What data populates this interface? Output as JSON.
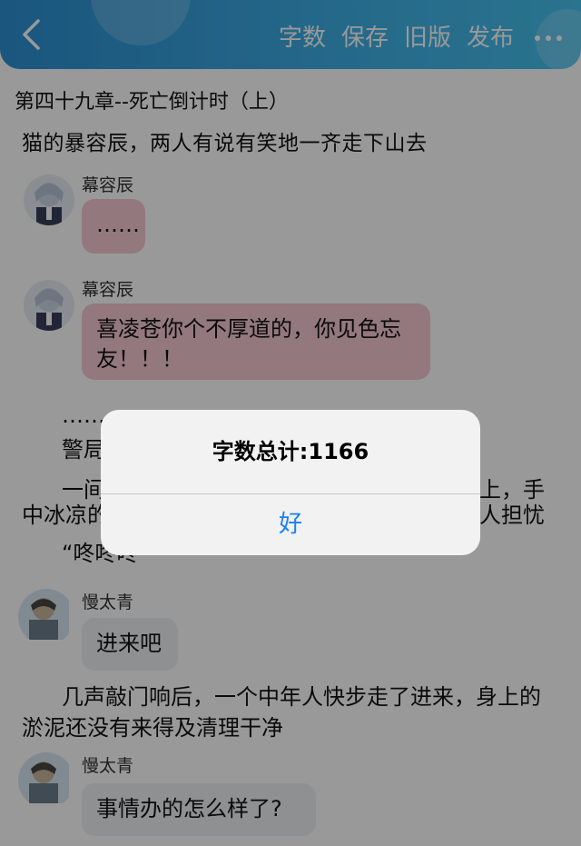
{
  "header": {
    "toolbar": [
      "字数",
      "保存",
      "旧版",
      "发布"
    ]
  },
  "chapter": {
    "title": "第四十九章--死亡倒计时（上）",
    "clipped_line": "猫的暴容辰，两人有说有笑地一齐走下山去"
  },
  "messages": [
    {
      "name": "幕容辰",
      "text": "……"
    },
    {
      "name": "幕容辰",
      "text": "喜凌苍你个不厚道的，你见色忘友！！！"
    },
    {
      "name": "慢太青",
      "text": "进来吧"
    },
    {
      "name": "慢太青",
      "text": "事情办的怎么样了?"
    }
  ],
  "paragraphs": {
    "dots": "……",
    "p1_start": "警局",
    "p2_start": "一间",
    "p2_end": "上，手",
    "p3_start": "中冰凉的",
    "p3_end": "人担忧",
    "p4_start": "“咚咚咚",
    "p5": "几声敲门响后，一个中年人快步走了进来，身上的淤泥还没有来得及清理干净"
  },
  "alert": {
    "message": "字数总计:1166",
    "button": "好"
  },
  "colors": {
    "header": "#3aa6df",
    "pink_bubble": "#f6c8d1",
    "gray_bubble": "#eef0f3",
    "alert_button": "#1a7ff6"
  }
}
